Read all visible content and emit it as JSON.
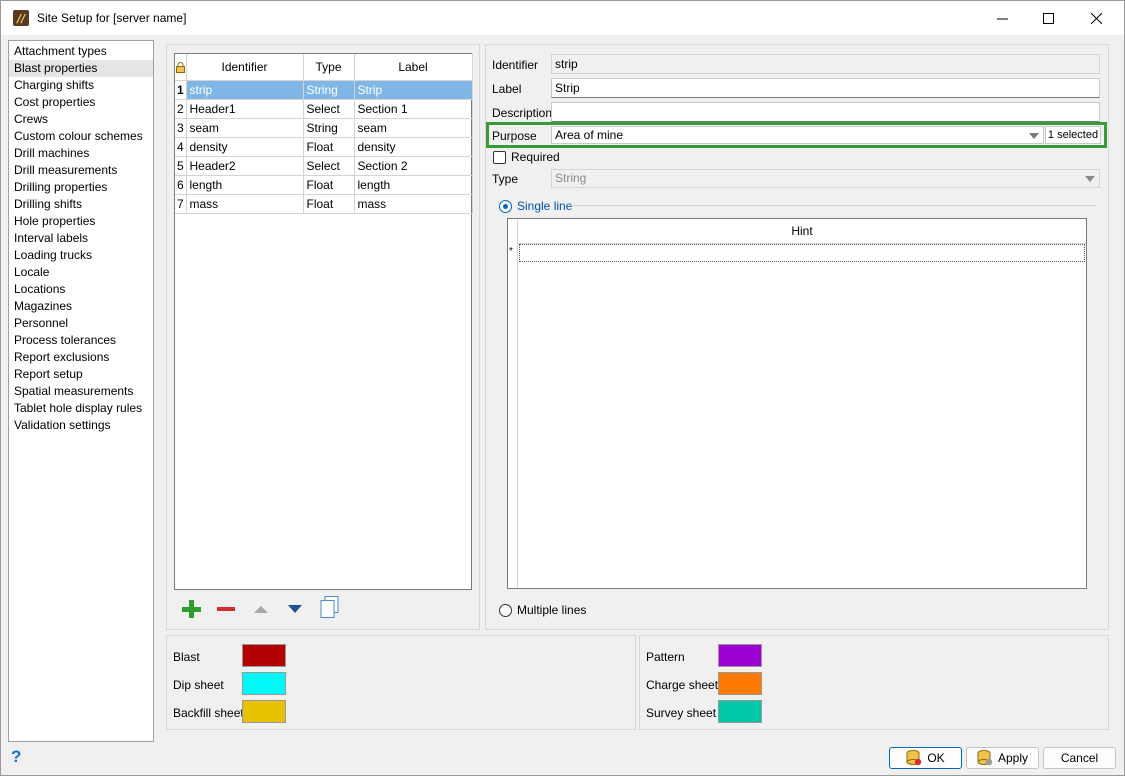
{
  "window": {
    "title": "Site Setup for [server name]"
  },
  "nav": {
    "items": [
      "Attachment types",
      "Blast properties",
      "Charging shifts",
      "Cost properties",
      "Crews",
      "Custom colour schemes",
      "Drill machines",
      "Drill measurements",
      "Drilling properties",
      "Drilling shifts",
      "Hole properties",
      "Interval labels",
      "Loading trucks",
      "Locale",
      "Locations",
      "Magazines",
      "Personnel",
      "Process tolerances",
      "Report exclusions",
      "Report setup",
      "Spatial measurements",
      "Tablet hole display rules",
      "Validation settings"
    ],
    "selected_index": 1
  },
  "grid": {
    "headers": [
      "Identifier",
      "Type",
      "Label"
    ],
    "rows": [
      {
        "n": "1",
        "identifier": "strip",
        "type": "String",
        "label": "Strip"
      },
      {
        "n": "2",
        "identifier": "Header1",
        "type": "Select",
        "label": "Section 1"
      },
      {
        "n": "3",
        "identifier": "seam",
        "type": "String",
        "label": "seam"
      },
      {
        "n": "4",
        "identifier": "density",
        "type": "Float",
        "label": "density"
      },
      {
        "n": "5",
        "identifier": "Header2",
        "type": "Select",
        "label": "Section 2"
      },
      {
        "n": "6",
        "identifier": "length",
        "type": "Float",
        "label": "length"
      },
      {
        "n": "7",
        "identifier": "mass",
        "type": "Float",
        "label": "mass"
      }
    ],
    "selected_row": 0
  },
  "detail": {
    "identifier_label": "Identifier",
    "identifier_value": "strip",
    "label_label": "Label",
    "label_value": "Strip",
    "description_label": "Description",
    "description_value": "",
    "purpose_label": "Purpose",
    "purpose_value": "Area of mine",
    "purpose_count": "1 selected",
    "required_label": "Required",
    "type_label": "Type",
    "type_value": "String",
    "single_line_label": "Single line",
    "hint_header": "Hint",
    "new_row_marker": "*",
    "multiple_lines_label": "Multiple lines"
  },
  "colors_left": [
    {
      "label": "Blast",
      "color": "#b00000"
    },
    {
      "label": "Dip sheet",
      "color": "#00f8f8"
    },
    {
      "label": "Backfill sheet",
      "color": "#e6c200"
    }
  ],
  "colors_right": [
    {
      "label": "Pattern",
      "color": "#9a00d0"
    },
    {
      "label": "Charge sheet",
      "color": "#ff7a00"
    },
    {
      "label": "Survey sheet",
      "color": "#00c8a8"
    }
  ],
  "buttons": {
    "ok": "OK",
    "apply": "Apply",
    "cancel": "Cancel",
    "help": "?"
  },
  "icons": {
    "app": "app-logo-icon",
    "lock": "lock-icon",
    "add": "plus-icon",
    "remove": "minus-icon",
    "up": "triangle-up-icon",
    "down": "triangle-down-icon",
    "copy": "copy-icon"
  }
}
